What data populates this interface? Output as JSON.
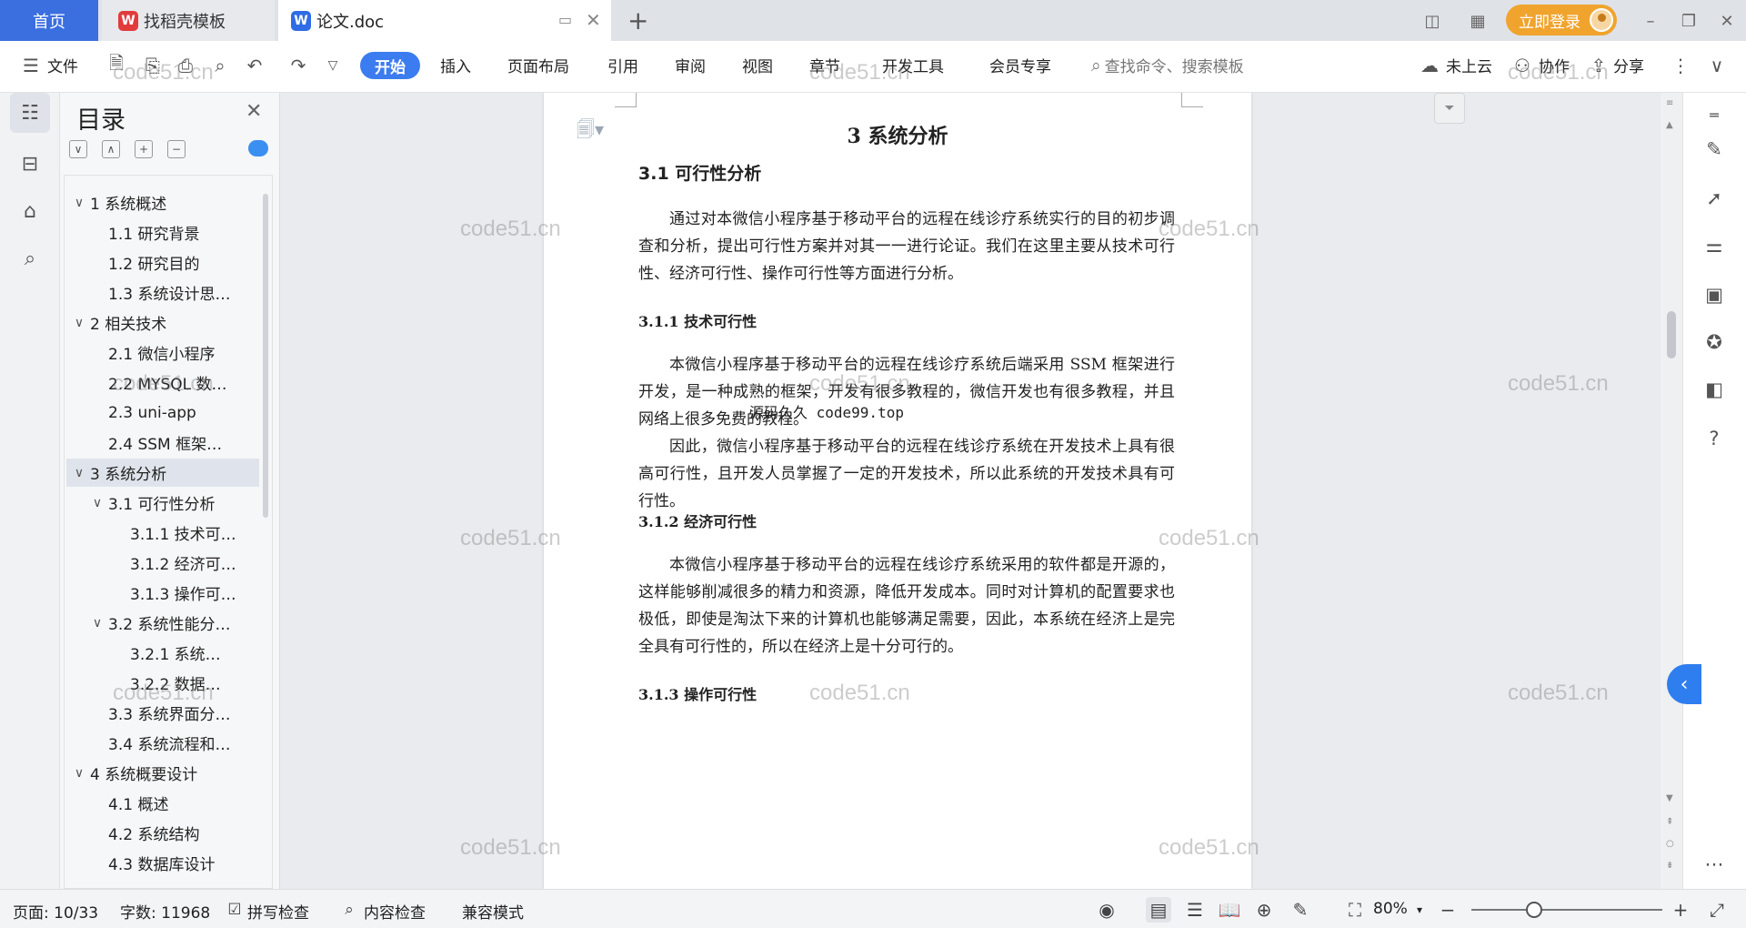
{
  "tabs": {
    "home": "首页",
    "template": "找稻壳模板",
    "doc": "论文.doc",
    "new_tab_icon": "plus-icon"
  },
  "window": {
    "login": "立即登录"
  },
  "ribbon": {
    "file": "文件",
    "start": "开始",
    "insert": "插入",
    "layout": "页面布局",
    "reference": "引用",
    "review": "审阅",
    "view": "视图",
    "chapter": "章节",
    "developer": "开发工具",
    "member": "会员专享",
    "search_placeholder": "查找命令、搜索模板",
    "cloud": "未上云",
    "collab": "协作",
    "share": "分享"
  },
  "toc": {
    "title": "目录",
    "items": [
      {
        "label": "1 系统概述",
        "level": 1,
        "arrow": "∨"
      },
      {
        "label": "1.1  研究背景",
        "level": 2,
        "arrow": ""
      },
      {
        "label": "1.2 研究目的",
        "level": 2,
        "arrow": ""
      },
      {
        "label": "1.3 系统设计思…",
        "level": 2,
        "arrow": ""
      },
      {
        "label": "2 相关技术",
        "level": 1,
        "arrow": "∨"
      },
      {
        "label": "2.1 微信小程序",
        "level": 2,
        "arrow": ""
      },
      {
        "label": "2.2 MYSQL 数…",
        "level": 2,
        "arrow": ""
      },
      {
        "label": "2.3 uni-app",
        "level": 2,
        "arrow": ""
      },
      {
        "label": "2.4 SSM 框架…",
        "level": 2,
        "arrow": ""
      },
      {
        "label": "3 系统分析",
        "level": 1,
        "arrow": "∨",
        "active": true
      },
      {
        "label": "3.1 可行性分析",
        "level": 2,
        "arrow": "∨"
      },
      {
        "label": "3.1.1 技术可…",
        "level": 3,
        "arrow": ""
      },
      {
        "label": "3.1.2 经济可…",
        "level": 3,
        "arrow": ""
      },
      {
        "label": "3.1.3 操作可…",
        "level": 3,
        "arrow": ""
      },
      {
        "label": "3.2 系统性能分…",
        "level": 2,
        "arrow": "∨"
      },
      {
        "label": "3.2.1  系统…",
        "level": 3,
        "arrow": ""
      },
      {
        "label": "3.2.2  数据…",
        "level": 3,
        "arrow": ""
      },
      {
        "label": "3.3 系统界面分…",
        "level": 2,
        "arrow": ""
      },
      {
        "label": "3.4 系统流程和…",
        "level": 2,
        "arrow": ""
      },
      {
        "label": "4 系统概要设计",
        "level": 1,
        "arrow": "∨"
      },
      {
        "label": "4.1 概述",
        "level": 2,
        "arrow": ""
      },
      {
        "label": "4.2 系统结构",
        "level": 2,
        "arrow": ""
      },
      {
        "label": "4.3 数据库设计",
        "level": 2,
        "arrow": ""
      }
    ]
  },
  "document": {
    "chapter_title": "3 系统分析",
    "s31": "3.1 可行性分析",
    "p1": "通过对本微信小程序基于移动平台的远程在线诊疗系统实行的目的初步调查和分析，提出可行性方案并对其一一进行论证。我们在这里主要从技术可行性、经济可行性、操作可行性等方面进行分析。",
    "s311": "3.1.1 技术可行性",
    "p2": "本微信小程序基于移动平台的远程在线诊疗系统后端采用 SSM 框架进行开发，是一种成熟的框架，开发有很多教程的，微信开发也有很多教程，并且网络上很多免费的教程。",
    "p3": "因此，微信小程序基于移动平台的远程在线诊疗系统在开发技术上具有很高可行性，且开发人员掌握了一定的开发技术，所以此系统的开发技术具有可行性。",
    "s312": "3.1.2 经济可行性",
    "p4": "本微信小程序基于移动平台的远程在线诊疗系统采用的软件都是开源的，这样能够削减很多的精力和资源，降低开发成本。同时对计算机的配置要求也极低，即使是淘汰下来的计算机也能够满足需要，因此，本系统在经济上是完全具有可行性的，所以在经济上是十分可行的。",
    "s313": "3.1.3 操作可行性",
    "overlay": "源码久久 code99.top"
  },
  "watermark": "code51.cn",
  "status": {
    "page": "页面: 10/33",
    "words": "字数: 11968",
    "spell": "拼写检查",
    "content_check": "内容检查",
    "compat": "兼容模式",
    "zoom": "80%",
    "zoom_level": 0.33
  },
  "colors": {
    "accent": "#3b7cf0",
    "login": "#f0a42d",
    "home_tab": "#3b6fe0"
  }
}
